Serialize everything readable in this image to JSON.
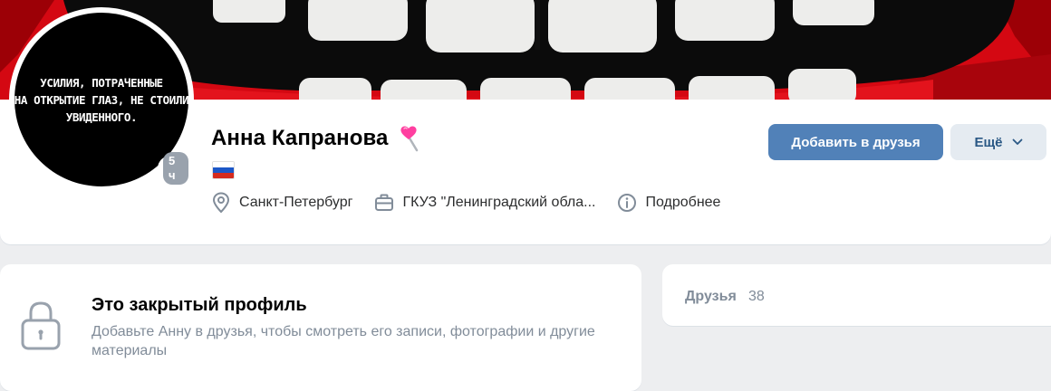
{
  "cover": {
    "image_name": "lips-teeth-cover",
    "colors": {
      "red": "#d40812",
      "black": "#0b0b0b",
      "teeth": "#ededeb"
    }
  },
  "avatar": {
    "lines": [
      "УСИЛИЯ, ПОТРАЧЕННЫЕ",
      "НА ОТКРЫТИЕ ГЛАЗ, НЕ СТОИЛИ",
      "УВИДЕННОГО."
    ],
    "last_seen": "5 ч"
  },
  "profile": {
    "name": "Анна Капранова",
    "emoji": "lollipop-heart-icon",
    "flag": "russia-flag-icon",
    "city": "Санкт-Петербург",
    "work": "ГКУЗ \"Ленинградский обла...",
    "details": "Подробнее"
  },
  "actions": {
    "add_friend": "Добавить в друзья",
    "more": "Ещё"
  },
  "closed_profile": {
    "title": "Это закрытый профиль",
    "description": "Добавьте Анну в друзья, чтобы смотреть его записи, фотографии и другие материалы"
  },
  "friends": {
    "label": "Друзья",
    "count": "38"
  },
  "colors": {
    "accent": "#5181b8",
    "secondary_button": "#e5ebf1",
    "muted_text": "#818c99",
    "page_bg": "#edeef0"
  }
}
